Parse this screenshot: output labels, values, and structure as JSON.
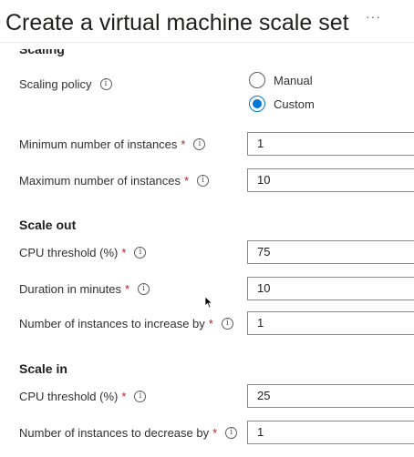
{
  "header": {
    "title": "Create a virtual machine scale set",
    "more_label": "···"
  },
  "scaling": {
    "heading": "Scaling",
    "policy_label": "Scaling policy",
    "options": [
      "Manual",
      "Custom"
    ],
    "selected": "Custom",
    "min_instances_label": "Minimum number of instances",
    "min_instances_value": "1",
    "max_instances_label": "Maximum number of instances",
    "max_instances_value": "10"
  },
  "scale_out": {
    "heading": "Scale out",
    "cpu_label": "CPU threshold (%)",
    "cpu_value": "75",
    "duration_label": "Duration in minutes",
    "duration_value": "10",
    "increase_label": "Number of instances to increase by",
    "increase_value": "1"
  },
  "scale_in": {
    "heading": "Scale in",
    "cpu_label": "CPU threshold (%)",
    "cpu_value": "25",
    "decrease_label": "Number of instances to decrease by",
    "decrease_value": "1"
  },
  "required_marker": "*",
  "info_glyph": "i"
}
